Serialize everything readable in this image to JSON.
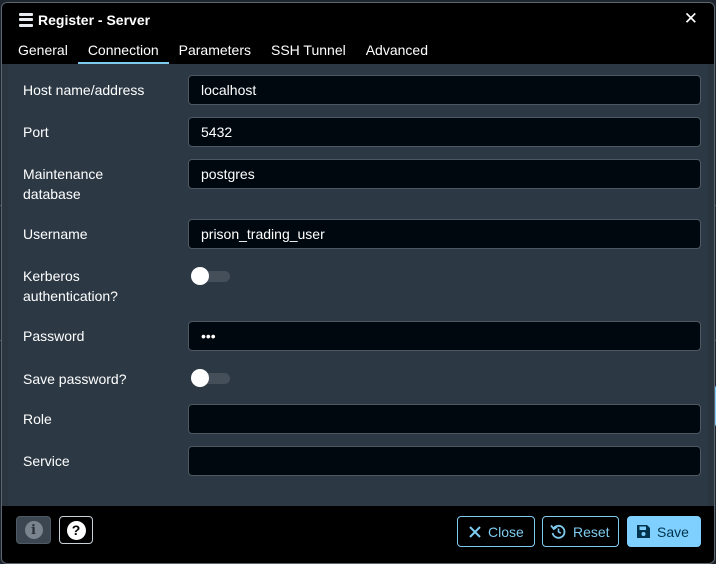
{
  "dialog": {
    "title": "Register - Server",
    "close_icon": "close-icon"
  },
  "tabs": [
    {
      "label": "General",
      "active": false
    },
    {
      "label": "Connection",
      "active": true
    },
    {
      "label": "Parameters",
      "active": false
    },
    {
      "label": "SSH Tunnel",
      "active": false
    },
    {
      "label": "Advanced",
      "active": false
    }
  ],
  "fields": {
    "host": {
      "label": "Host name/address",
      "value": "localhost"
    },
    "port": {
      "label": "Port",
      "value": "5432"
    },
    "maintenance_db": {
      "label": "Maintenance database",
      "value": "postgres"
    },
    "username": {
      "label": "Username",
      "value": "prison_trading_user"
    },
    "kerberos": {
      "label": "Kerberos authentication?",
      "on": false
    },
    "password": {
      "label": "Password",
      "value": "•••"
    },
    "save_password": {
      "label": "Save password?",
      "on": false
    },
    "role": {
      "label": "Role",
      "value": ""
    },
    "service": {
      "label": "Service",
      "value": ""
    }
  },
  "footer": {
    "info_icon": "info-icon",
    "help_icon": "help-icon",
    "close_label": "Close",
    "reset_label": "Reset",
    "save_label": "Save"
  },
  "colors": {
    "accent": "#7fd0ff",
    "dialog_bg": "#2c3945",
    "input_bg": "#00080f"
  }
}
